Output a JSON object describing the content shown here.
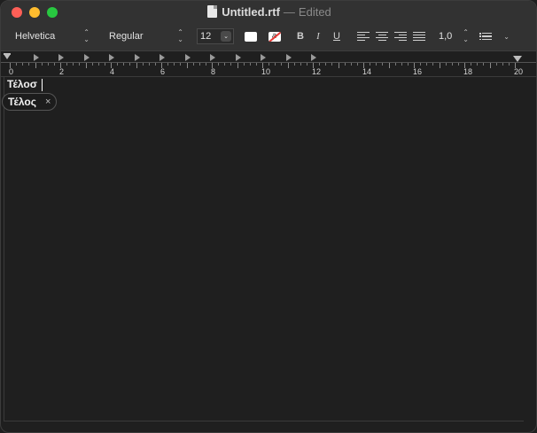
{
  "window": {
    "filename": "Untitled.rtf",
    "separator": "—",
    "status": "Edited"
  },
  "toolbar": {
    "font_family": "Helvetica",
    "font_style": "Regular",
    "font_size": "12",
    "bold_label": "B",
    "italic_label": "I",
    "underline_label": "U",
    "line_spacing": "1,0",
    "text_color": "#ffffff",
    "background_color": "#ffffff"
  },
  "ruler": {
    "numbers": [
      "0",
      "2",
      "4",
      "6",
      "8",
      "10",
      "12",
      "14",
      "16",
      "18",
      "20"
    ]
  },
  "document": {
    "text": "Τέλοσ"
  },
  "autocorrect": {
    "suggestion": "Τέλος",
    "dismiss_label": "×"
  },
  "colors": {
    "close": "#fe5f57",
    "minimize": "#febc2e",
    "maximize": "#28c840"
  }
}
